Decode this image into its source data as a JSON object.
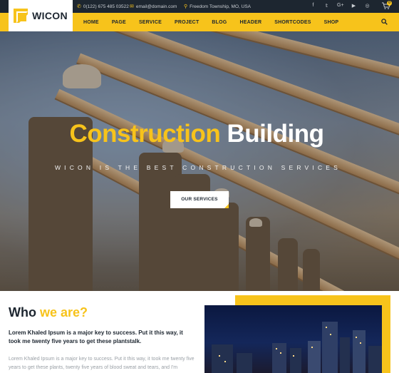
{
  "topbar": {
    "phone": "0(122) 675 485 03522",
    "email": "email@domain.com",
    "address": "Freedom Township, MO, USA",
    "social": [
      "facebook-icon",
      "twitter-icon",
      "google-plus-icon",
      "youtube-icon",
      "instagram-icon"
    ]
  },
  "logo": {
    "text": "WICON"
  },
  "nav": {
    "items": [
      "HOME",
      "PAGE",
      "SERVICE",
      "PROJECT",
      "BLOG",
      "HEADER",
      "SHORTCODES",
      "SHOP"
    ],
    "cart_count": "0"
  },
  "hero": {
    "title_highlight": "Construction",
    "title_rest": "Building",
    "subtitle": "WICON IS THE BEST CONSTRUCTION SERVICES",
    "button": "OUR SERVICES"
  },
  "about": {
    "heading_dark": "Who",
    "heading_highlight": "we are?",
    "lead": "Lorem Khaled Ipsum is a major key to success. Put it this way, it took me twenty five years to get these plantstalk.",
    "body": "Lorem Khaled Ipsum is a major key to success. Put it this way, it took me twenty five years to get these plants, twenty five years of blood sweat and tears, and I'm"
  },
  "colors": {
    "accent": "#f7c31b",
    "dark": "#1d2630"
  }
}
